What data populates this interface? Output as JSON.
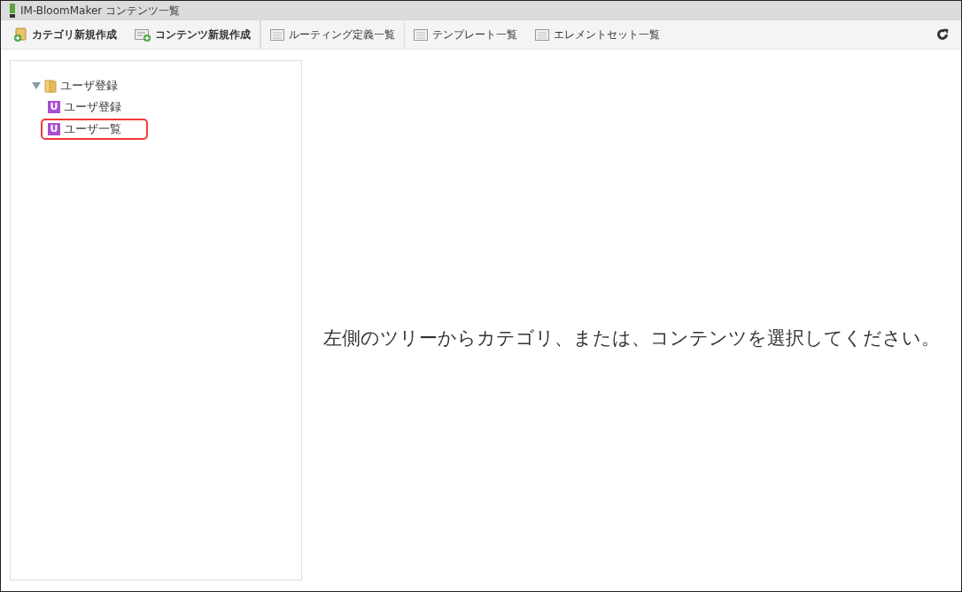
{
  "window": {
    "title": "IM-BloomMaker コンテンツ一覧"
  },
  "toolbar": [
    {
      "label": "カテゴリ新規作成",
      "kind": "new-category",
      "bold": true
    },
    {
      "label": "コンテンツ新規作成",
      "kind": "new-content",
      "bold": true
    },
    {
      "label": "ルーティング定義一覧",
      "kind": "list",
      "bold": false
    },
    {
      "label": "テンプレート一覧",
      "kind": "list",
      "bold": false
    },
    {
      "label": "エレメントセット一覧",
      "kind": "list",
      "bold": false
    }
  ],
  "tree": [
    {
      "label": "ユーザ登録",
      "kind": "folder",
      "expanded": true,
      "children": [
        {
          "label": "ユーザ登録",
          "kind": "content",
          "icon_letter": "U",
          "highlighted": false
        },
        {
          "label": "ユーザ一覧",
          "kind": "content",
          "icon_letter": "U",
          "highlighted": true
        }
      ]
    }
  ],
  "message": "左側のツリーからカテゴリ、または、コンテンツを選択してください。"
}
